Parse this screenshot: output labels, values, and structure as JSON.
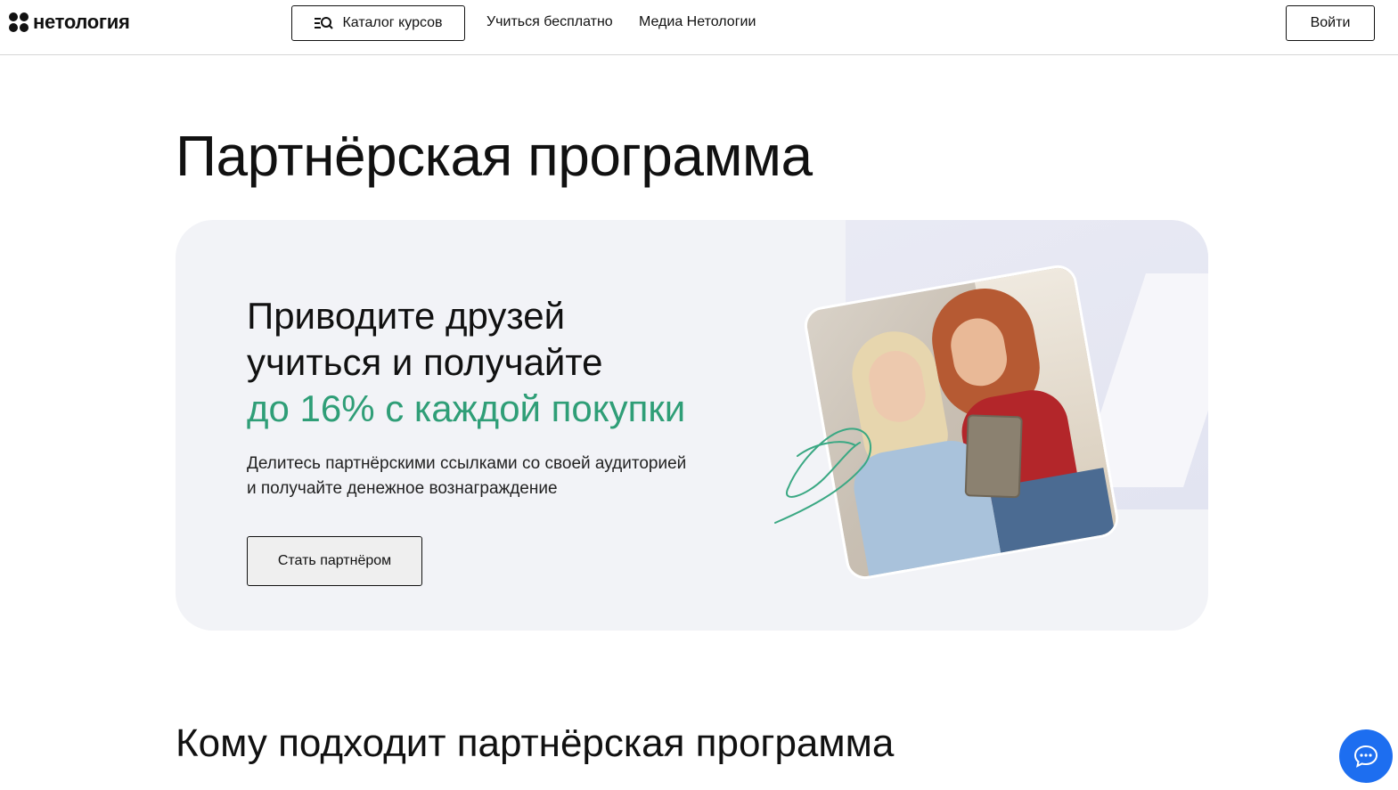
{
  "header": {
    "logo_text": "нетология",
    "catalog_label": "Каталог курсов",
    "nav": [
      "Учиться бесплатно",
      "Медиа Нетологии"
    ],
    "login_label": "Войти"
  },
  "page_title": "Партнёрская программа",
  "hero": {
    "heading_line1": "Приводите друзей",
    "heading_line2": "учиться и получайте",
    "heading_accent": "до 16% с каждой покупки",
    "text_line1": "Делитесь партнёрскими ссылками со своей аудиторией",
    "text_line2": "и получайте денежное вознаграждение",
    "button_label": "Стать партнёром"
  },
  "section_title": "Кому подходит партнёрская программа",
  "colors": {
    "accent": "#2f9e77",
    "chat": "#1d6ef0",
    "card_bg": "#f2f3f7"
  },
  "icons": {
    "catalog": "search-menu-icon",
    "chat": "chat-bubble-icon"
  }
}
